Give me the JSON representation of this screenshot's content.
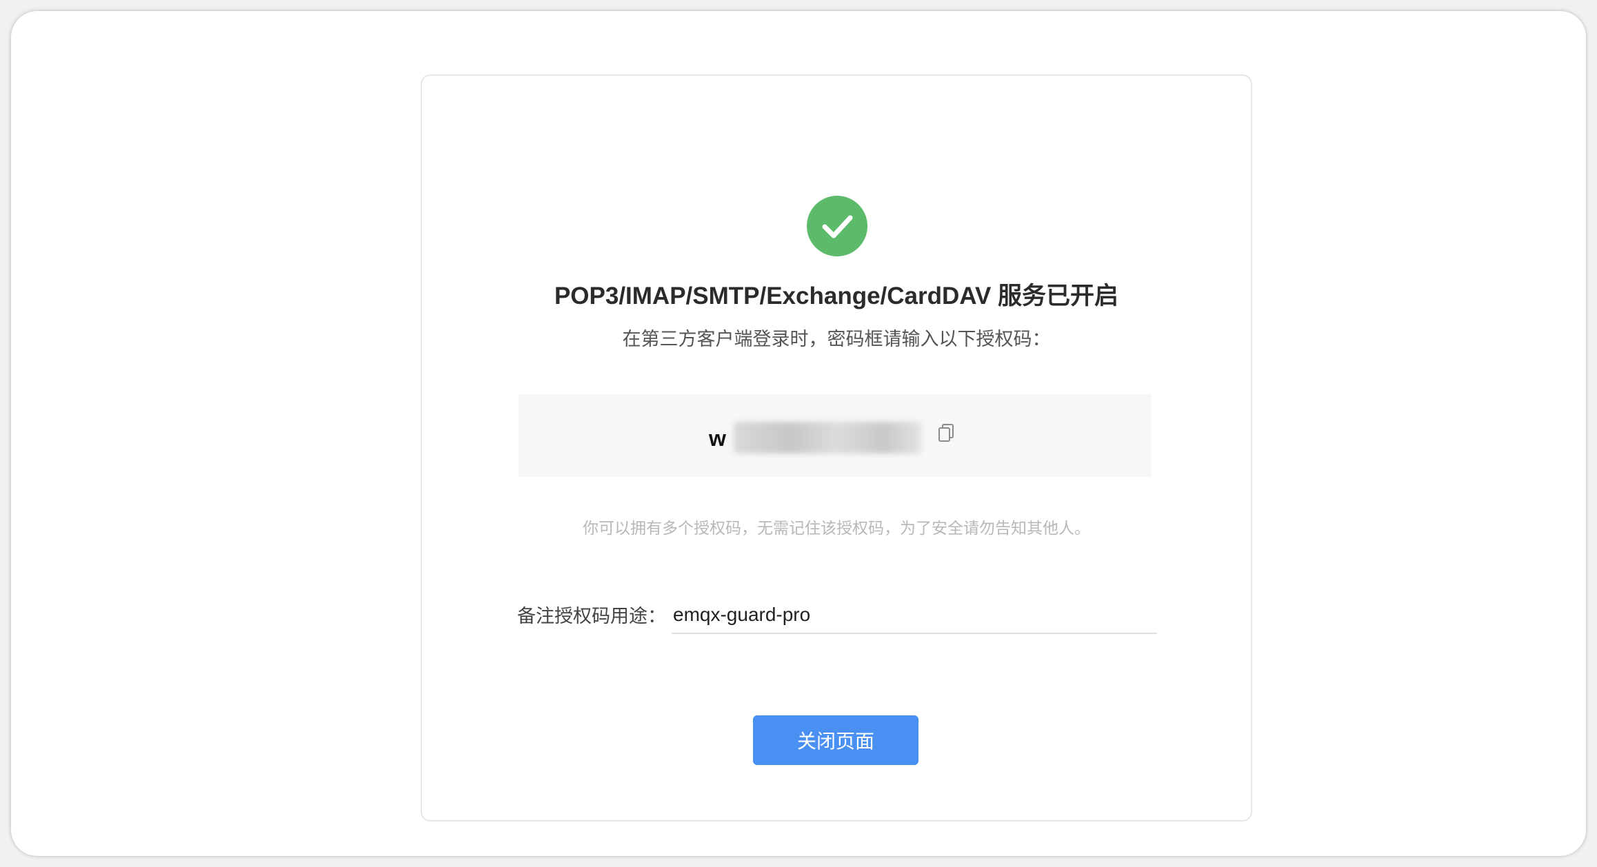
{
  "success": {
    "icon": "check-circle-icon",
    "color": "#5cbb6b"
  },
  "title": "POP3/IMAP/SMTP/Exchange/CardDAV 服务已开启",
  "subtitle": "在第三方客户端登录时，密码框请输入以下授权码：",
  "auth_code": {
    "visible_prefix": "w",
    "copy_icon": "copy-icon"
  },
  "hint": "你可以拥有多个授权码，无需记住该授权码，为了安全请勿告知其他人。",
  "note": {
    "label": "备注授权码用途：",
    "value": "emqx-guard-pro"
  },
  "close_button": {
    "label": "关闭页面",
    "color": "#4a90f2"
  }
}
